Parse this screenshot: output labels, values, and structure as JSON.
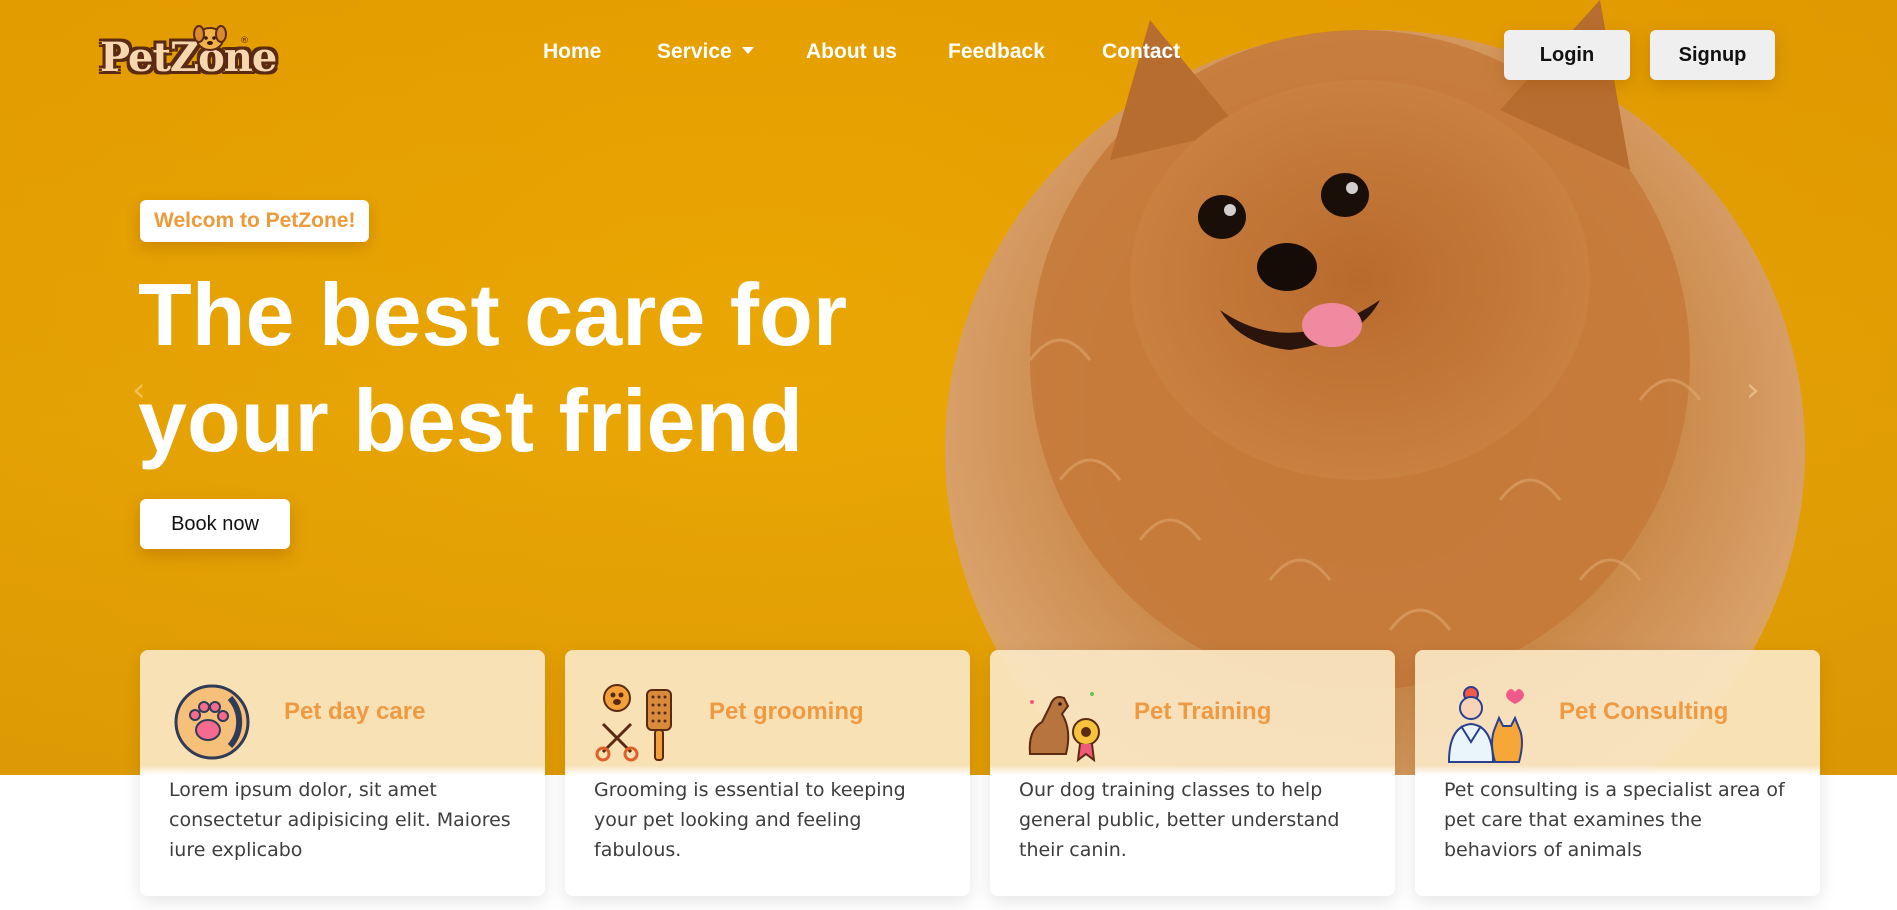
{
  "brand": {
    "name": "PetZone",
    "reg_mark": "®"
  },
  "nav": {
    "items": [
      "Home",
      "Service",
      "About us",
      "Feedback",
      "Contact"
    ],
    "login_label": "Login",
    "signup_label": "Signup"
  },
  "hero": {
    "badge": "Welcom to PetZone!",
    "headline_line1": "The best care for",
    "headline_line2": "your best friend",
    "cta_label": "Book now",
    "prev_arrow": "‹",
    "next_arrow": "›"
  },
  "services": [
    {
      "icon": "paw-circle-icon",
      "title": "Pet day care",
      "description": "Lorem ipsum dolor, sit amet consectetur adipisicing elit. Maiores iure explicabo"
    },
    {
      "icon": "grooming-scissors-brush-icon",
      "title": "Pet grooming",
      "description": "Grooming is essential to keeping your pet looking and feeling fabulous."
    },
    {
      "icon": "dog-medal-icon",
      "title": "Pet Training",
      "description": "Our dog training classes to help general public, better understand their canin."
    },
    {
      "icon": "vet-with-cat-icon",
      "title": "Pet Consulting",
      "description": "Pet consulting is a specialist area of pet care that examines the behaviors of animals"
    }
  ],
  "colors": {
    "hero_background": "#eaa704",
    "accent_orange": "#ef9a42",
    "card_tint": "#fae7c4",
    "logo_brown": "#5a2a12"
  }
}
